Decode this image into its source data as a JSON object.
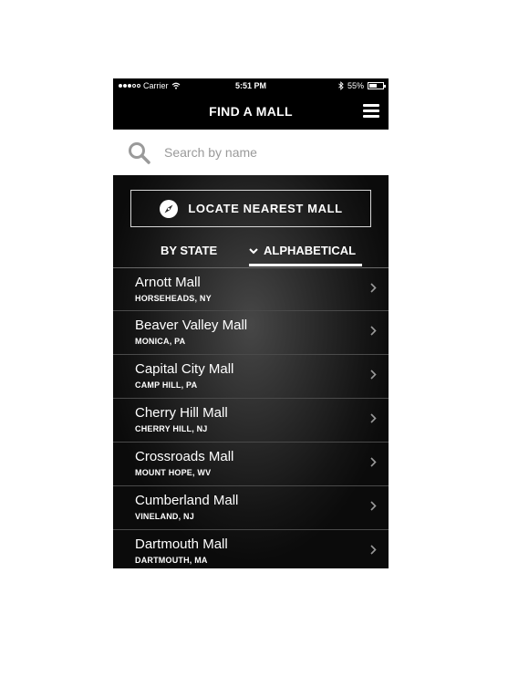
{
  "status_bar": {
    "carrier": "Carrier",
    "time": "5:51 PM",
    "battery_text": "55%",
    "battery_level": 0.55
  },
  "nav": {
    "title": "FIND A MALL"
  },
  "search": {
    "placeholder": "Search by name"
  },
  "locate": {
    "label": "LOCATE NEAREST MALL"
  },
  "tabs": [
    {
      "label": "BY STATE"
    },
    {
      "label": "ALPHABETICAL",
      "active": true
    }
  ],
  "malls": [
    {
      "name": "Arnott Mall",
      "location": "HORSEHEADS, NY"
    },
    {
      "name": "Beaver Valley Mall",
      "location": "MONICA, PA"
    },
    {
      "name": "Capital City Mall",
      "location": "CAMP HILL, PA"
    },
    {
      "name": "Cherry Hill Mall",
      "location": "CHERRY HILL, NJ"
    },
    {
      "name": "Crossroads Mall",
      "location": "MOUNT HOPE, WV"
    },
    {
      "name": "Cumberland Mall",
      "location": "VINELAND, NJ"
    },
    {
      "name": "Dartmouth Mall",
      "location": "DARTMOUTH, MA"
    }
  ],
  "icons": {
    "signal": "signal-dots-icon",
    "wifi": "wifi-icon",
    "bluetooth": "bluetooth-icon",
    "battery": "battery-icon",
    "menu": "hamburger-menu-icon",
    "search": "search-icon",
    "compass": "compass-icon",
    "chevron_down": "chevron-down-icon",
    "chevron_right": "chevron-right-icon"
  }
}
